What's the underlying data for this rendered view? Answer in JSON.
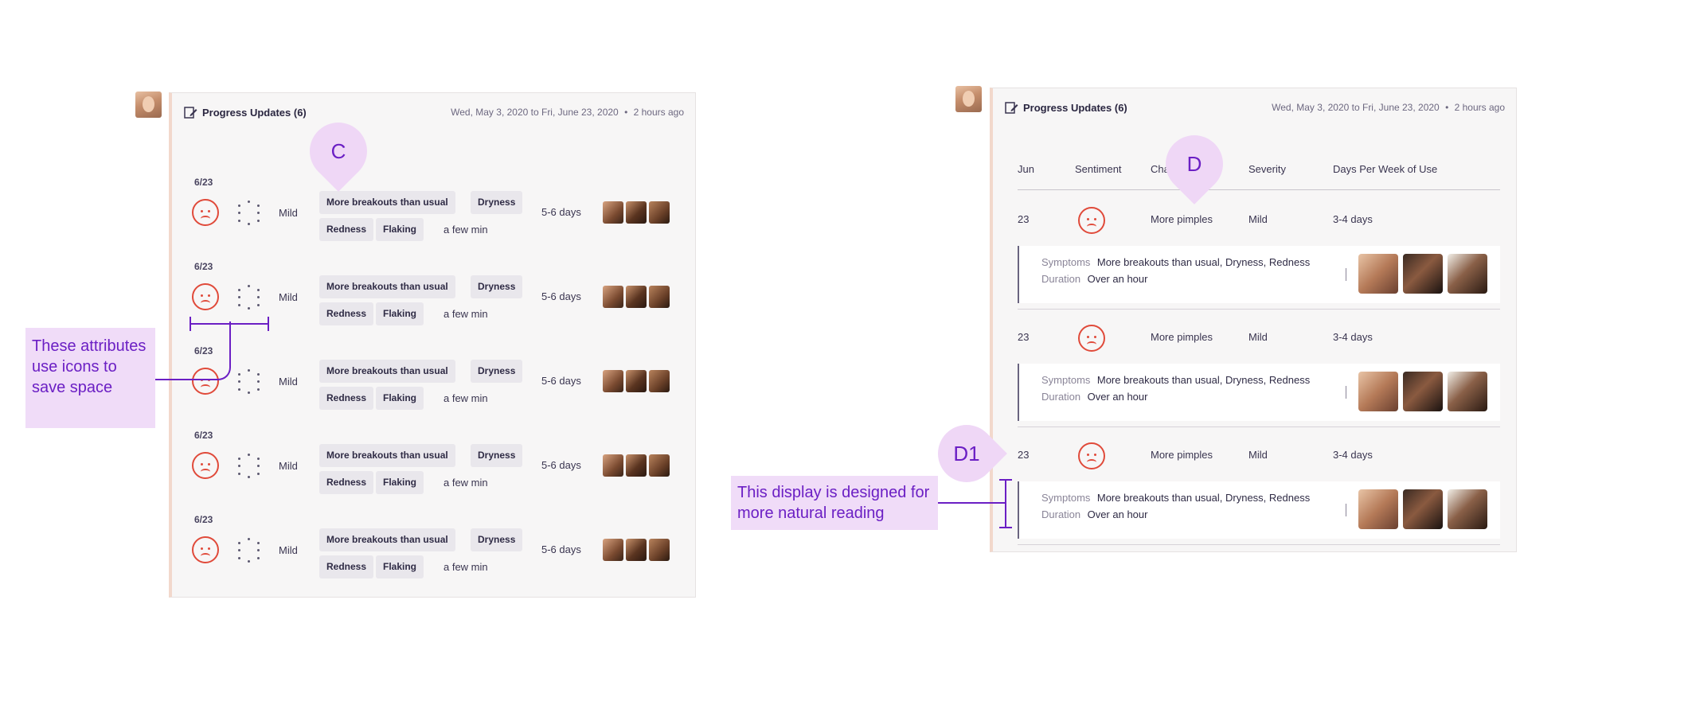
{
  "panel_c": {
    "title": "Progress Updates (6)",
    "date_range": "Wed, May 3, 2020 to Fri, June 23, 2020",
    "separator": "•",
    "time_ago": "2 hours ago",
    "marker": "C",
    "rows": [
      {
        "date": "6/23",
        "severity": "Mild",
        "chips_top": [
          "More breakouts than usual",
          "Dryness"
        ],
        "chips_bottom": [
          "Redness",
          "Flaking"
        ],
        "duration": "a few min",
        "days": "5-6 days"
      },
      {
        "date": "6/23",
        "severity": "Mild",
        "chips_top": [
          "More breakouts than usual",
          "Dryness"
        ],
        "chips_bottom": [
          "Redness",
          "Flaking"
        ],
        "duration": "a few min",
        "days": "5-6 days"
      },
      {
        "date": "6/23",
        "severity": "Mild",
        "chips_top": [
          "More breakouts than usual",
          "Dryness"
        ],
        "chips_bottom": [
          "Redness",
          "Flaking"
        ],
        "duration": "a few min",
        "days": "5-6 days"
      },
      {
        "date": "6/23",
        "severity": "Mild",
        "chips_top": [
          "More breakouts than usual",
          "Dryness"
        ],
        "chips_bottom": [
          "Redness",
          "Flaking"
        ],
        "duration": "a few min",
        "days": "5-6 days"
      },
      {
        "date": "6/23",
        "severity": "Mild",
        "chips_top": [
          "More breakouts than usual",
          "Dryness"
        ],
        "chips_bottom": [
          "Redness",
          "Flaking"
        ],
        "duration": "a few min",
        "days": "5-6 days"
      }
    ],
    "annotation": "These attributes use icons to save space"
  },
  "panel_d": {
    "title": "Progress Updates (6)",
    "date_range": "Wed, May 3, 2020 to Fri, June 23, 2020",
    "separator": "•",
    "time_ago": "2 hours ago",
    "marker": "D",
    "marker2": "D1",
    "columns": [
      "Jun",
      "Sentiment",
      "Cha",
      "Severity",
      "Days Per Week of Use"
    ],
    "rows": [
      {
        "day": "23",
        "change": "More pimples",
        "severity": "Mild",
        "days": "3-4 days",
        "symptoms_label": "Symptoms",
        "symptoms": "More breakouts than usual, Dryness, Redness",
        "duration_label": "Duration",
        "duration": "Over an hour"
      },
      {
        "day": "23",
        "change": "More pimples",
        "severity": "Mild",
        "days": "3-4 days",
        "symptoms_label": "Symptoms",
        "symptoms": "More breakouts than usual, Dryness, Redness",
        "duration_label": "Duration",
        "duration": "Over an hour"
      },
      {
        "day": "23",
        "change": "More pimples",
        "severity": "Mild",
        "days": "3-4 days",
        "symptoms_label": "Symptoms",
        "symptoms": "More breakouts than usual, Dryness, Redness",
        "duration_label": "Duration",
        "duration": "Over an hour"
      }
    ],
    "annotation": "This display is designed for more natural reading"
  },
  "colors": {
    "accent": "#6b1fc4",
    "annotation_bg": "#f0dcf8",
    "sad": "#e04a3a",
    "card_border": "#f2d8cc"
  }
}
